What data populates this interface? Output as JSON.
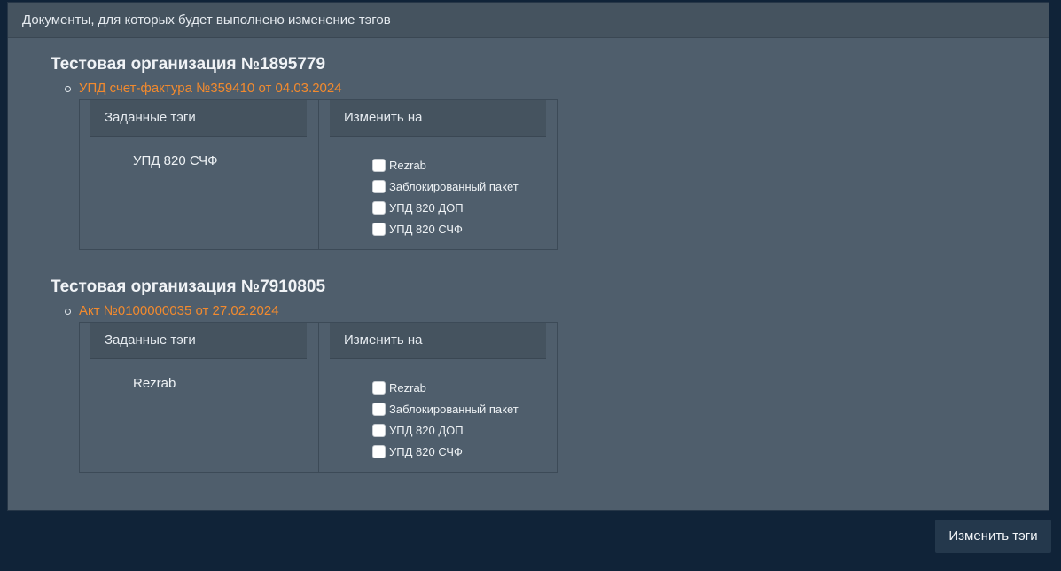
{
  "panel": {
    "header": "Документы, для которых будет выполнено изменение тэгов"
  },
  "organizations": [
    {
      "title": "Тестовая организация №1895779",
      "document": "УПД счет-фактура №359410 от 04.03.2024",
      "assigned_header": "Заданные тэги",
      "change_header": "Изменить на",
      "assigned_tag": "УПД 820 СЧФ",
      "options": [
        "Rezrab",
        "Заблокированный пакет",
        "УПД 820 ДОП",
        "УПД 820 СЧФ"
      ]
    },
    {
      "title": "Тестовая организация №7910805",
      "document": "Акт №0100000035 от 27.02.2024",
      "assigned_header": "Заданные тэги",
      "change_header": "Изменить на",
      "assigned_tag": "Rezrab",
      "options": [
        "Rezrab",
        "Заблокированный пакет",
        "УПД 820 ДОП",
        "УПД 820 СЧФ"
      ]
    }
  ],
  "actions": {
    "submit_label": "Изменить тэги"
  },
  "colors": {
    "page_background": "#102338",
    "panel_background": "#4f5e6c",
    "document_link": "#f28a2e",
    "button_background": "#24384c"
  }
}
